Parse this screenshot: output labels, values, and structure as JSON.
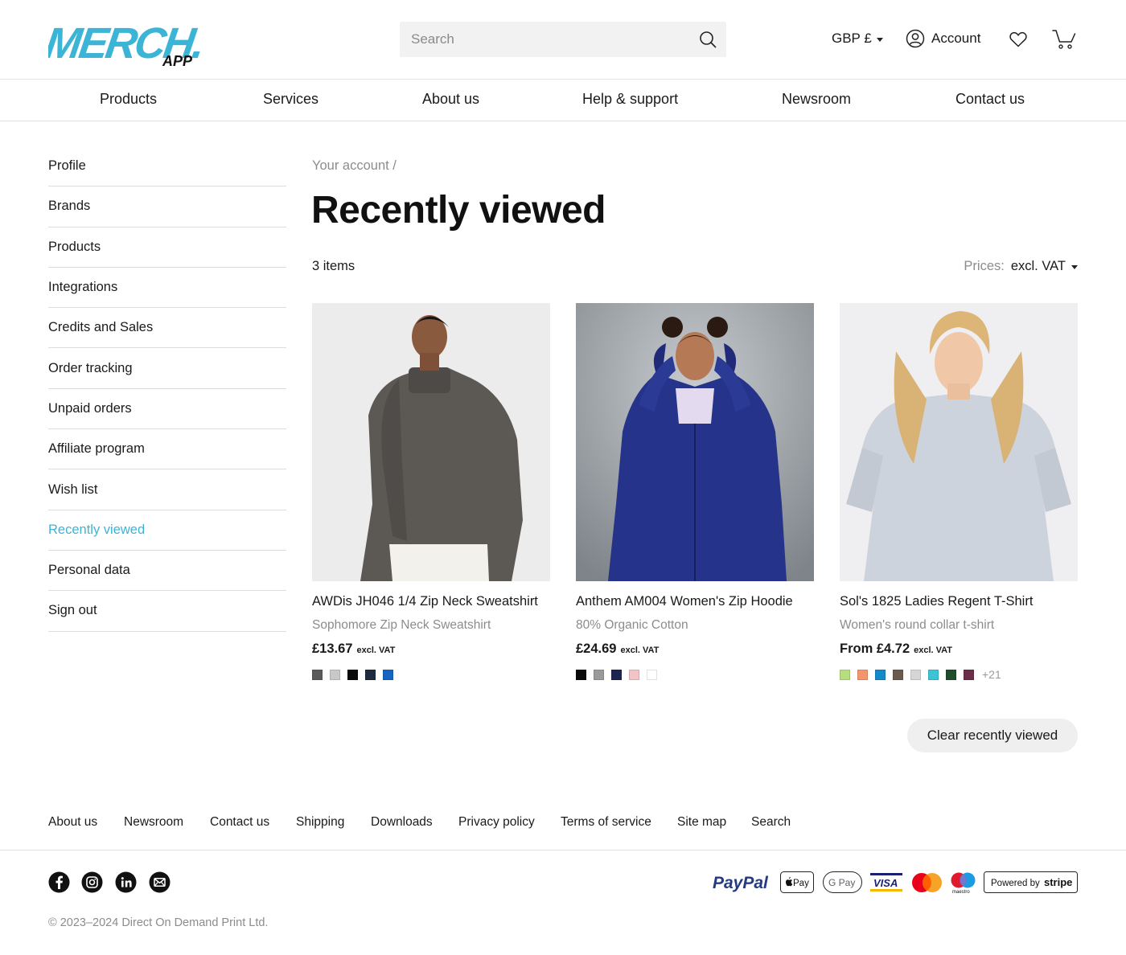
{
  "header": {
    "logo_text": "MERCH.",
    "logo_sub": "APP",
    "search_placeholder": "Search",
    "currency": "GBP £",
    "account": "Account"
  },
  "nav": [
    "Products",
    "Services",
    "About us",
    "Help & support",
    "Newsroom",
    "Contact us"
  ],
  "sidebar": [
    {
      "label": "Profile"
    },
    {
      "label": "Brands"
    },
    {
      "label": "Products"
    },
    {
      "label": "Integrations"
    },
    {
      "label": "Credits and Sales"
    },
    {
      "label": "Order tracking"
    },
    {
      "label": "Unpaid orders"
    },
    {
      "label": "Affiliate program"
    },
    {
      "label": "Wish list"
    },
    {
      "label": "Recently viewed",
      "active": true
    },
    {
      "label": "Personal data"
    },
    {
      "label": "Sign out"
    }
  ],
  "main": {
    "breadcrumb": "Your account /",
    "title": "Recently viewed",
    "count": "3 items",
    "prices_label": "Prices:",
    "prices_value": "excl. VAT",
    "clear_button": "Clear recently viewed"
  },
  "products": [
    {
      "name": "AWDis JH046 1/4 Zip Neck Sweatshirt",
      "subtitle": "Sophomore Zip Neck Sweatshirt",
      "price": "£13.67",
      "vat": "excl. VAT",
      "swatches": [
        "#5a5a5a",
        "#c8c8c8",
        "#0a0a0a",
        "#1f2a3f",
        "#1565c0"
      ],
      "more": ""
    },
    {
      "name": "Anthem AM004 Women's Zip Hoodie",
      "subtitle": "80% Organic Cotton",
      "price": "£24.69",
      "vat": "excl. VAT",
      "swatches": [
        "#0a0a0a",
        "#9a9a9a",
        "#1c2550",
        "#f2c4c8",
        "#ffffff"
      ],
      "more": ""
    },
    {
      "name": "Sol's 1825 Ladies Regent T-Shirt",
      "subtitle": "Women's round collar t-shirt",
      "price": "From £4.72",
      "vat": "excl. VAT",
      "swatches": [
        "#b6dd7e",
        "#f4956c",
        "#1389c9",
        "#6b5a4e",
        "#d6d6d6",
        "#3cc3d6",
        "#1f4d2b",
        "#6b2e4a"
      ],
      "more": "+21"
    }
  ],
  "footer": {
    "links": [
      "About us",
      "Newsroom",
      "Contact us",
      "Shipping",
      "Downloads",
      "Privacy policy",
      "Terms of service",
      "Site map",
      "Search"
    ],
    "copyright": "© 2023–2024 Direct On Demand Print Ltd.",
    "payments": {
      "paypal": "PayPal",
      "applepay": "Pay",
      "gpay": "G Pay",
      "visa": "VISA",
      "maestro": "maestro",
      "stripe_prefix": "Powered by",
      "stripe_brand": "stripe"
    }
  },
  "colors": {
    "accent": "#3bb4d6",
    "logo": "#3bb4d6"
  }
}
